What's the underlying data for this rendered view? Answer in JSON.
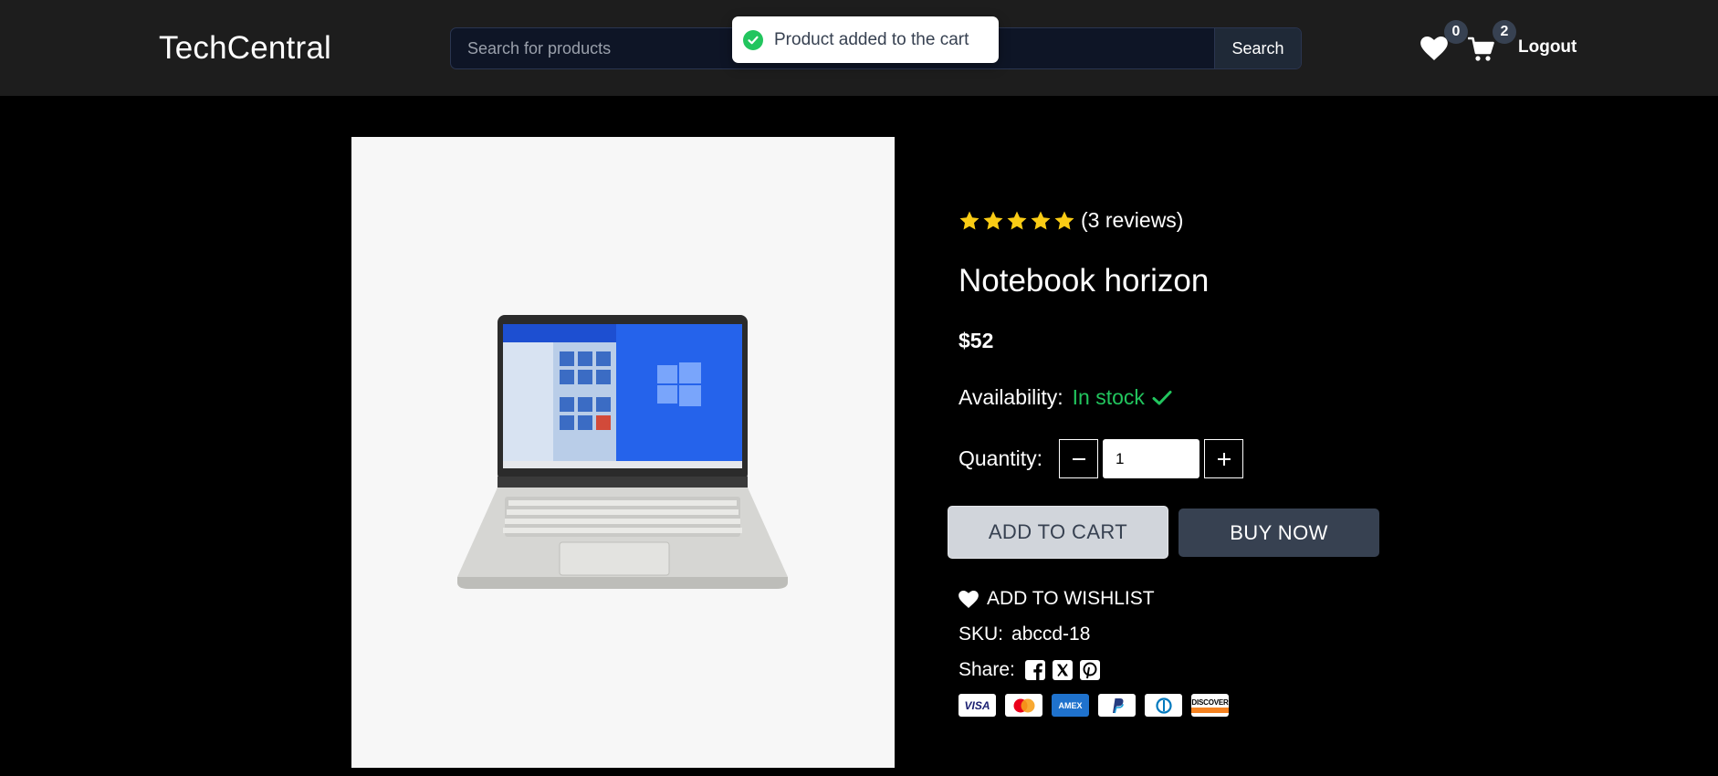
{
  "header": {
    "logo": "TechCentral",
    "search": {
      "placeholder": "Search for products",
      "button_label": "Search"
    },
    "wishlist_count": "0",
    "cart_count": "2",
    "logout_label": "Logout"
  },
  "toast": {
    "message": "Product added to the cart"
  },
  "product": {
    "rating_stars": 5,
    "reviews": "(3 reviews)",
    "title": "Notebook horizon",
    "price": "$52",
    "availability_label": "Availability:",
    "availability_value": "In stock",
    "quantity_label": "Quantity:",
    "quantity_value": "1",
    "add_to_cart_label": "ADD TO CART",
    "buy_now_label": "BUY NOW",
    "wishlist_label": "ADD TO WISHLIST",
    "sku_label": "SKU:",
    "sku_value": "abccd-18",
    "share_label": "Share:",
    "share_icons": [
      "facebook-icon",
      "x-icon",
      "pinterest-icon"
    ],
    "payment_methods": [
      "VISA",
      "Mastercard",
      "AMEX",
      "PayPal",
      "Diners",
      "DISCOVER"
    ]
  },
  "colors": {
    "header_bg": "#1d1d1d",
    "page_bg": "#000000",
    "star": "#facc15",
    "in_stock": "#22c55e",
    "buy_now_bg": "#374151",
    "add_to_cart_bg": "#d1d5db"
  }
}
